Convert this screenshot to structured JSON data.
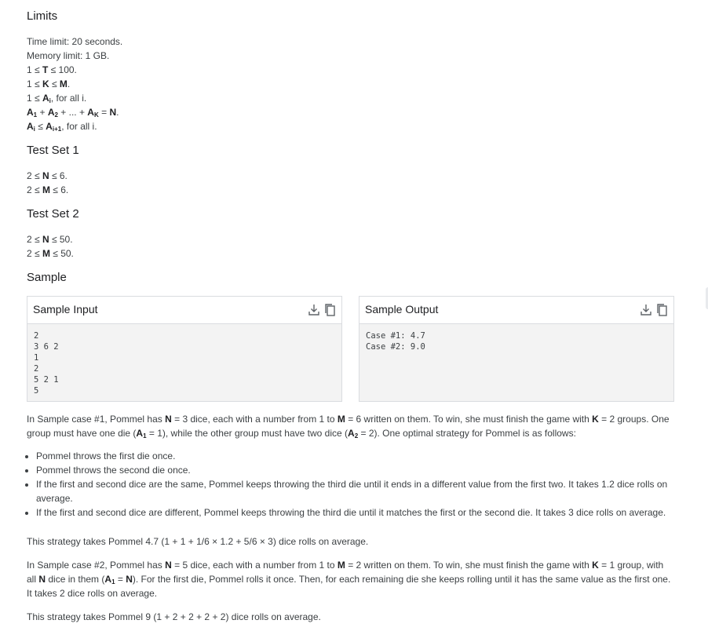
{
  "sections": {
    "limits": "Limits",
    "test_set_1": "Test Set 1",
    "test_set_2": "Test Set 2",
    "sample": "Sample"
  },
  "limits": {
    "time": "Time limit: 20 seconds.",
    "memory": "Memory limit: 1 GB."
  },
  "samples": {
    "input_title": "Sample Input",
    "output_title": "Sample Output",
    "input_text": "2\n3 6 2\n1\n2\n5 2 1\n5",
    "output_text": "Case #1: 4.7\nCase #2: 9.0"
  },
  "explanation": {
    "strategy_summary_1": "This strategy takes Pommel 4.7 (1 + 1 + 1/6 × 1.2 + 5/6 × 3) dice rolls on average.",
    "strategy_summary_2": "This strategy takes Pommel 9 (1 + 2 + 2 + 2 + 2) dice rolls on average.",
    "bullets": [
      "Pommel throws the first die once.",
      "Pommel throws the second die once.",
      "If the first and second dice are the same, Pommel keeps throwing the third die until it ends in a different value from the first two. It takes 1.2 dice rolls on average.",
      "If the first and second dice are different, Pommel keeps throwing the third die until it matches the first or the second die. It takes 3 dice rolls on average."
    ]
  }
}
